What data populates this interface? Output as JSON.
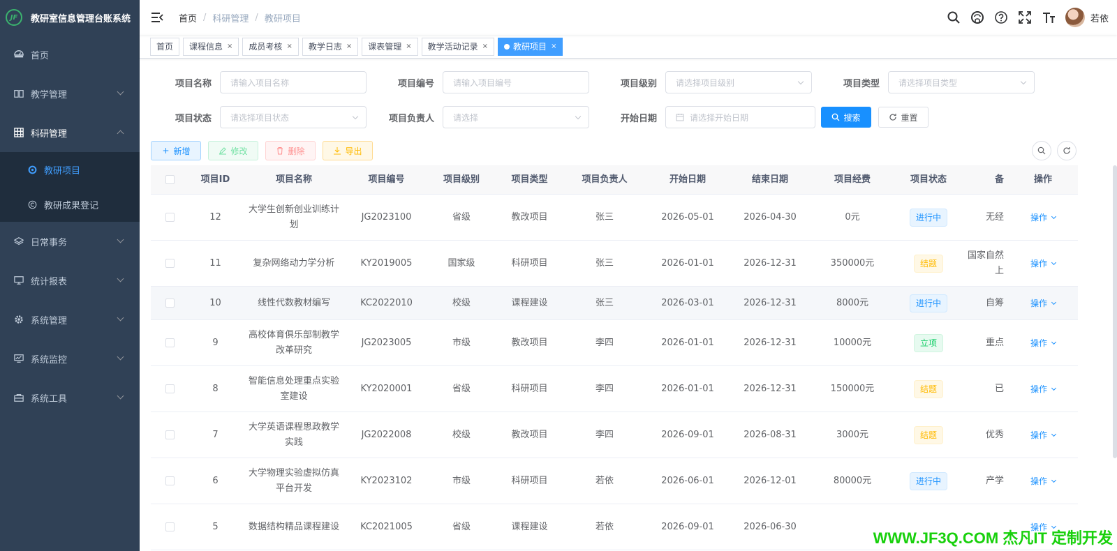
{
  "app": {
    "title": "教研室信息管理台账系统",
    "logo_text": "JF"
  },
  "sidebar": {
    "items": [
      {
        "label": "首页",
        "icon": "dashboard-icon"
      },
      {
        "label": "教学管理",
        "icon": "book-icon"
      },
      {
        "label": "科研管理",
        "icon": "grid-icon",
        "open": true,
        "children": [
          {
            "label": "教研项目",
            "icon": "project-icon",
            "active": true
          },
          {
            "label": "教研成果登记",
            "icon": "copyright-icon"
          }
        ]
      },
      {
        "label": "日常事务",
        "icon": "layers-icon"
      },
      {
        "label": "统计报表",
        "icon": "monitor-icon"
      },
      {
        "label": "系统管理",
        "icon": "gear-icon"
      },
      {
        "label": "系统监控",
        "icon": "chart-monitor-icon"
      },
      {
        "label": "系统工具",
        "icon": "toolbox-icon"
      }
    ]
  },
  "navbar": {
    "breadcrumb": [
      "首页",
      "科研管理",
      "教研项目"
    ],
    "username": "若依"
  },
  "tags": [
    {
      "label": "首页",
      "closable": false
    },
    {
      "label": "课程信息",
      "closable": true
    },
    {
      "label": "成员考核",
      "closable": true
    },
    {
      "label": "教学日志",
      "closable": true
    },
    {
      "label": "课表管理",
      "closable": true
    },
    {
      "label": "教学活动记录",
      "closable": true
    },
    {
      "label": "教研项目",
      "closable": true,
      "active": true
    }
  ],
  "search": {
    "project_name": {
      "label": "项目名称",
      "placeholder": "请输入项目名称"
    },
    "project_code": {
      "label": "项目编号",
      "placeholder": "请输入项目编号"
    },
    "project_level": {
      "label": "项目级别",
      "placeholder": "请选择项目级别"
    },
    "project_type": {
      "label": "项目类型",
      "placeholder": "请选择项目类型"
    },
    "project_status": {
      "label": "项目状态",
      "placeholder": "请选择项目状态"
    },
    "project_leader": {
      "label": "项目负责人",
      "placeholder": "请选择"
    },
    "start_date": {
      "label": "开始日期",
      "placeholder": "请选择开始日期"
    },
    "search_btn": "搜索",
    "reset_btn": "重置"
  },
  "toolbar": {
    "add": "新增",
    "edit": "修改",
    "delete": "删除",
    "export": "导出"
  },
  "table": {
    "headers": [
      "项目ID",
      "项目名称",
      "项目编号",
      "项目级别",
      "项目类型",
      "项目负责人",
      "开始日期",
      "结束日期",
      "项目经费",
      "项目状态",
      "备",
      "操作"
    ],
    "op_label": "操作",
    "rows": [
      {
        "id": "12",
        "name": "大学生创新创业训练计划",
        "code": "JG2023100",
        "level": "省级",
        "type": "教改项目",
        "leader": "张三",
        "start": "2026-05-01",
        "end": "2026-04-30",
        "fund": "0元",
        "status": "进行中",
        "status_kind": "blue",
        "remark": "无经"
      },
      {
        "id": "11",
        "name": "复杂网络动力学分析",
        "code": "KY2019005",
        "level": "国家级",
        "type": "科研项目",
        "leader": "张三",
        "start": "2026-01-01",
        "end": "2026-12-31",
        "fund": "350000元",
        "status": "结题",
        "status_kind": "yellow",
        "remark": "国家自然上"
      },
      {
        "id": "10",
        "name": "线性代数教材编写",
        "code": "KC2022010",
        "level": "校级",
        "type": "课程建设",
        "leader": "张三",
        "start": "2026-03-01",
        "end": "2026-12-31",
        "fund": "8000元",
        "status": "进行中",
        "status_kind": "blue",
        "remark": "自筹"
      },
      {
        "id": "9",
        "name": "高校体育俱乐部制教学改革研究",
        "code": "JG2023005",
        "level": "市级",
        "type": "教改项目",
        "leader": "李四",
        "start": "2026-01-01",
        "end": "2026-12-31",
        "fund": "10000元",
        "status": "立项",
        "status_kind": "green",
        "remark": "重点"
      },
      {
        "id": "8",
        "name": "智能信息处理重点实验室建设",
        "code": "KY2020001",
        "level": "省级",
        "type": "科研项目",
        "leader": "李四",
        "start": "2026-01-01",
        "end": "2026-12-31",
        "fund": "150000元",
        "status": "结题",
        "status_kind": "yellow",
        "remark": "已"
      },
      {
        "id": "7",
        "name": "大学英语课程思政教学实践",
        "code": "JG2022008",
        "level": "校级",
        "type": "教改项目",
        "leader": "李四",
        "start": "2026-09-01",
        "end": "2026-08-31",
        "fund": "3000元",
        "status": "结题",
        "status_kind": "yellow",
        "remark": "优秀"
      },
      {
        "id": "6",
        "name": "大学物理实验虚拟仿真平台开发",
        "code": "KY2023102",
        "level": "市级",
        "type": "科研项目",
        "leader": "若依",
        "start": "2026-06-01",
        "end": "2026-12-01",
        "fund": "80000元",
        "status": "进行中",
        "status_kind": "blue",
        "remark": "产学"
      },
      {
        "id": "5",
        "name": "数据结构精品课程建设",
        "code": "KC2021005",
        "level": "省级",
        "type": "课程建设",
        "leader": "若依",
        "start": "2026-09-01",
        "end": "2026-06-30",
        "fund": "",
        "status": "",
        "status_kind": "",
        "remark": ""
      }
    ]
  },
  "watermark": "WWW.JF3Q.COM 杰凡IT  定制开发",
  "colors": {
    "sidebar_bg": "#304156",
    "primary": "#1890ff",
    "submenu_bg": "#1f2d3d"
  }
}
